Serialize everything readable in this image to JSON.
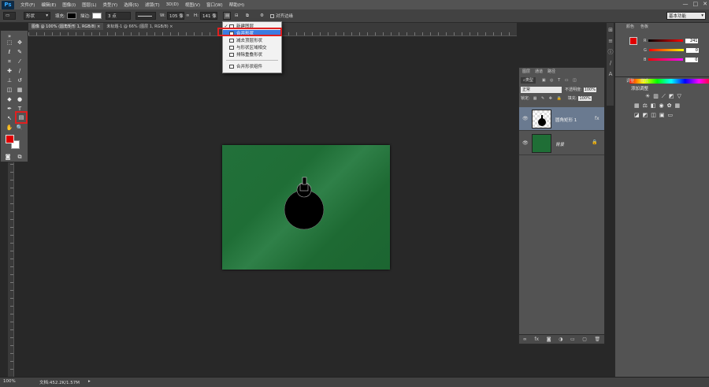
{
  "menubar": {
    "logo": "Ps",
    "items": [
      "文件(F)",
      "编辑(E)",
      "图像(I)",
      "图层(L)",
      "类型(Y)",
      "选择(S)",
      "滤镜(T)",
      "3D(D)",
      "视图(V)",
      "窗口(W)",
      "帮助(H)"
    ],
    "window_controls": [
      "—",
      "□",
      "✕"
    ]
  },
  "optbar": {
    "mode": "形状",
    "fill_label": "填充:",
    "stroke_label": "描边:",
    "stroke_width": "3 点",
    "w_label": "W:",
    "w_value": "105 像",
    "h_label": "H:",
    "h_value": "141 像",
    "align_edges": "对齐边缘",
    "workspace": "基本功能"
  },
  "tabs": [
    "图像 @ 100% (圆角矩形 1, RGB/8) ×",
    "未标题-1 @ 66% (图层 1, RGB/8) ×"
  ],
  "dropdown": {
    "items": [
      {
        "label": "新建图层",
        "checked": true
      },
      {
        "label": "合并形状",
        "checked": false,
        "selected": true
      },
      {
        "label": "减去顶层形状",
        "checked": false
      },
      {
        "label": "与形状区域相交",
        "checked": false
      },
      {
        "label": "排除重叠形状",
        "checked": false
      }
    ],
    "merge_components": "合并形状组件"
  },
  "color_panel": {
    "tabs": [
      "颜色",
      "色板"
    ],
    "r_label": "R",
    "r_value": "241",
    "g_label": "G",
    "g_value": "0",
    "b_label": "B",
    "b_value": "0"
  },
  "adjustments_panel": {
    "tabs": [
      "调整",
      "样式"
    ],
    "title": "添加调整"
  },
  "layers_panel": {
    "tabs": [
      "图层",
      "通道",
      "路径"
    ],
    "kind": "类型",
    "blend_mode": "正常",
    "opacity_label": "不透明度:",
    "opacity_value": "100%",
    "lock_label": "锁定:",
    "fill_label": "填充:",
    "fill_value": "100%",
    "layers": [
      {
        "name": "圆角矩形 1",
        "selected": true
      },
      {
        "name": "背景",
        "selected": false
      }
    ]
  },
  "status": {
    "zoom": "100%",
    "doc": "文档:452.2K/1.57M"
  },
  "colors": {
    "foreground": "#e00000",
    "background": "#ffffff",
    "canvas_green": "#1f6e36",
    "highlight_red": "#e02020"
  }
}
